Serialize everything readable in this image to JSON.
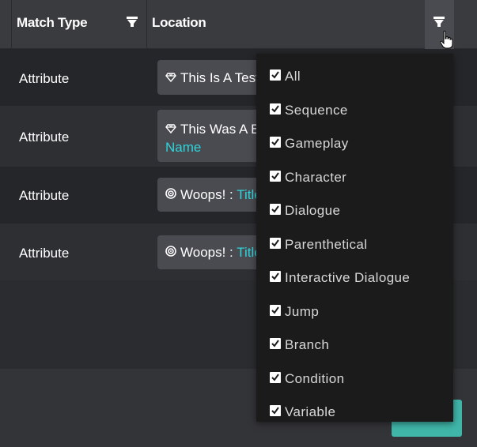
{
  "header": {
    "match_type_label": "Match Type",
    "location_label": "Location"
  },
  "rows": [
    {
      "type": "Attribute",
      "icon": "diamond-icon",
      "text": "This Is A Test",
      "highlight": ""
    },
    {
      "type": "Attribute",
      "icon": "diamond-icon",
      "text": "This Was A B",
      "highlight": "Name"
    },
    {
      "type": "Attribute",
      "icon": "target-icon",
      "text": "Woops! : ",
      "highlight": "Title"
    },
    {
      "type": "Attribute",
      "icon": "target-icon",
      "text": "Woops! : ",
      "highlight": "Title"
    }
  ],
  "filter_dropdown": {
    "items": [
      {
        "label": "All",
        "checked": true
      },
      {
        "label": "Sequence",
        "checked": true
      },
      {
        "label": "Gameplay",
        "checked": true
      },
      {
        "label": "Character",
        "checked": true
      },
      {
        "label": "Dialogue",
        "checked": true
      },
      {
        "label": "Parenthetical",
        "checked": true
      },
      {
        "label": "Interactive Dialogue",
        "checked": true
      },
      {
        "label": "Jump",
        "checked": true
      },
      {
        "label": "Branch",
        "checked": true
      },
      {
        "label": "Condition",
        "checked": true
      },
      {
        "label": "Variable",
        "checked": true
      }
    ]
  },
  "colors": {
    "accent_teal": "#2ed5db",
    "button_teal": "#3fb6a8",
    "dropdown_bg": "#1b1b1c"
  }
}
